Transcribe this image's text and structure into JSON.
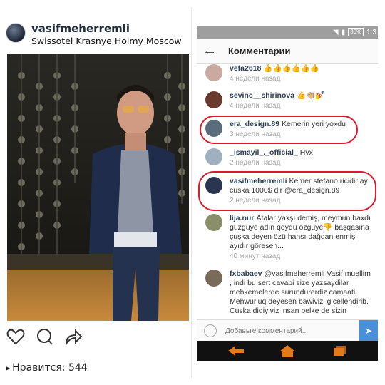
{
  "post": {
    "username": "vasifmeherremli",
    "location": "Swissotel Krasnye Holmy Moscow",
    "likes_label": "Нравится: 544"
  },
  "phone": {
    "battery": "30%",
    "time": "1:3",
    "title": "Комментарии",
    "input_placeholder": "Добавьте комментарий...",
    "comments": [
      {
        "user": "vefa2618",
        "text": "👍👍👍👍👍👍",
        "time": "4 недели назад"
      },
      {
        "user": "sevinc__shirinova",
        "text": "👍👏🏼💅",
        "time": "4 недели назад"
      },
      {
        "user": "era_design.89",
        "text": "Kemerin yeri yoxdu",
        "time": "3 недели назад"
      },
      {
        "user": "_ismayil_._official_",
        "text": "Hvx",
        "time": "2 недели назад"
      },
      {
        "user": "vasifmeherremli",
        "text": "Kemer stefano ricidir ay cuska 1000$ dir @era_design.89",
        "time": "2 недели назад"
      },
      {
        "user": "lija.nur",
        "text": "Atalar yaxşı demiş, meymun baxdı güzgüye adın qoydu özgüye👎 başqasına çuşka deyen özü hansı dağdan enmiş ayıdır göresen...",
        "time": "40 минут назад"
      },
      {
        "user": "fxbabaev",
        "text": "@vasifmeherremli Vasif muellim , indi bu sert cavabi size yazsaydilar mehkemelerde surundurerdiz camaati. Mehwurluq deyesen bawivizi gicellendirib. Cuska didiyiviz insan belke de sizin",
        "time": ""
      }
    ]
  },
  "colors": {
    "highlight": "#e0182c",
    "send": "#4a90d9"
  }
}
